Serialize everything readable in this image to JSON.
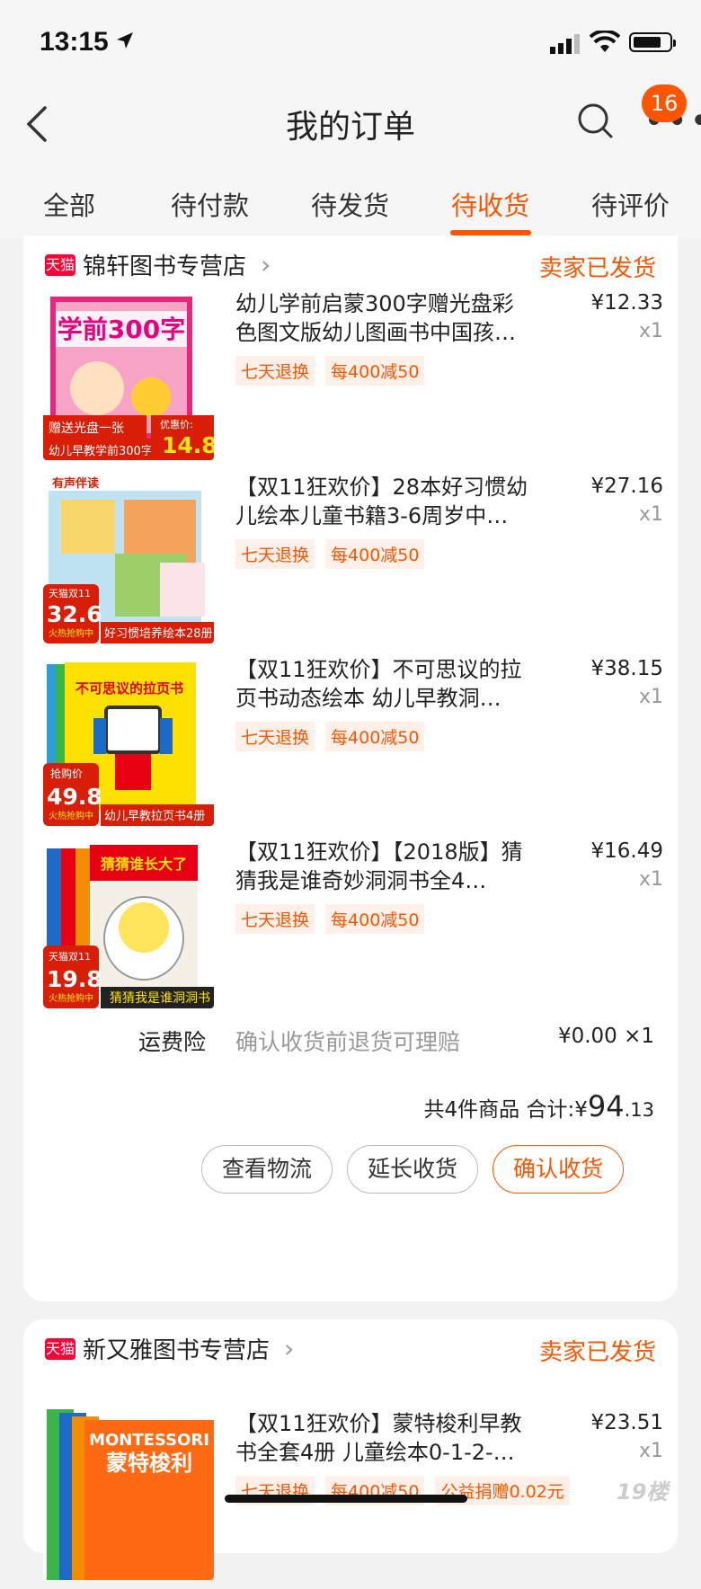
{
  "status_bar": {
    "time": "13:15"
  },
  "header": {
    "title": "我的订单",
    "badge_count": "16"
  },
  "tabs": [
    {
      "label": "全部"
    },
    {
      "label": "待付款"
    },
    {
      "label": "待发货"
    },
    {
      "label": "待收货",
      "active": true
    },
    {
      "label": "待评价"
    }
  ],
  "orders": [
    {
      "tmall_label": "天猫",
      "shop_name": "锦轩图书专营店",
      "shop_arrow": "›",
      "status": "卖家已发货",
      "items": [
        {
          "title": "幼儿学前启蒙300字赠光盘彩色图文版幼儿图画书中国孩…",
          "price": "¥12.33",
          "qty": "x1",
          "tags": [
            "七天退换",
            "每400减50"
          ],
          "thumb": {
            "main": "学前300字",
            "sub": "赠送光盘一张",
            "bottom": "幼儿早教学前300字",
            "price_label": "优惠价:",
            "price": "14.8"
          }
        },
        {
          "title": "【双11狂欢价】28本好习惯幼儿绘本儿童书籍3-6周岁中…",
          "price": "¥27.16",
          "qty": "x1",
          "tags": [
            "七天退换",
            "每400减50"
          ],
          "thumb": {
            "top": "有声伴读",
            "badge": "天猫双11",
            "price": "32.6",
            "hot": "火热抢购中",
            "bottom": "好习惯培养绘本28册"
          }
        },
        {
          "title": "【双11狂欢价】不可思议的拉页书动态绘本 幼儿早教洞…",
          "price": "¥38.15",
          "qty": "x1",
          "tags": [
            "七天退换",
            "每400减50"
          ],
          "thumb": {
            "top": "不可思议的拉页书",
            "badge": "抢购价",
            "price": "49.8",
            "hot": "火热抢购中",
            "bottom": "幼儿早教拉页书4册"
          }
        },
        {
          "title": "【双11狂欢价】【2018版】猜猜我是谁奇妙洞洞书全4…",
          "price": "¥16.49",
          "qty": "x1",
          "tags": [
            "七天退换",
            "每400减50"
          ],
          "thumb": {
            "top": "猜猜谁长大了",
            "badge": "天猫双11",
            "price": "19.8",
            "hot": "火热抢购中",
            "bottom": "猜猜我是谁洞洞书"
          }
        }
      ],
      "insurance": {
        "label": "运费险",
        "desc": "确认收货前退货可理赔",
        "price": "¥0.00 ×1"
      },
      "summary": {
        "count_text": "共4件商品 合计:",
        "currency": "¥",
        "amount_int": "94",
        "amount_dec": ".13"
      },
      "buttons": [
        "查看物流",
        "延长收货",
        "确认收货"
      ]
    },
    {
      "tmall_label": "天猫",
      "shop_name": "新又雅图书专营店",
      "shop_arrow": "›",
      "status": "卖家已发货",
      "items": [
        {
          "title": "【双11狂欢价】蒙特梭利早教书全套4册 儿童绘本0-1-2-…",
          "price": "¥23.51",
          "qty": "x1",
          "tags": [
            "七天退换",
            "每400减50",
            "公益捐赠0.02元"
          ],
          "thumb": {
            "top": "MONTESSORI",
            "main": "蒙特梭利"
          }
        }
      ]
    }
  ],
  "watermark": "19楼",
  "colors": {
    "accent": "#ff5500",
    "tmall": "#ff0036"
  }
}
